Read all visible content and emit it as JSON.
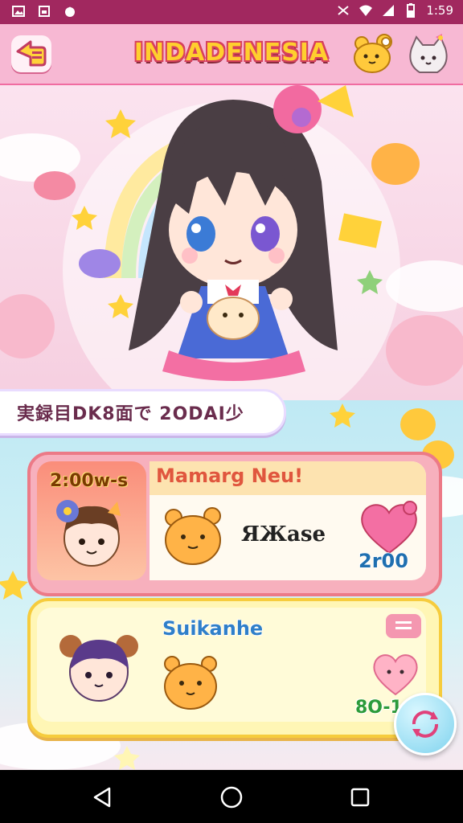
{
  "status_bar": {
    "time": "1:59",
    "left_icons": [
      "gallery-icon",
      "sim-icon",
      "notification-icon"
    ],
    "right_icons": [
      "vibrate-icon",
      "wifi-icon",
      "signal-icon",
      "battery-icon"
    ]
  },
  "app_bar": {
    "title": "INDADENESIA",
    "back_icon": "back-arrow-icon",
    "right_icons": [
      "bear-icon",
      "cat-icon"
    ]
  },
  "banner": {
    "text": "実録目DK8面で 2ODAI少"
  },
  "cards": [
    {
      "time": "2:00w-s",
      "name": "Mamarg Neu!",
      "label": "ЯЖаse",
      "count": "2r00",
      "icons": [
        "boy-avatar-icon",
        "bear-icon",
        "heart-icon"
      ]
    },
    {
      "title": "Suikanhe",
      "count": "8O-1.",
      "icons": [
        "girl-avatar-icon",
        "bear-icon",
        "heart-icon",
        "menu-icon"
      ]
    }
  ],
  "fab_icon": "refresh-icon",
  "nav_bar": {
    "icons": [
      "nav-back-icon",
      "nav-home-icon",
      "nav-recents-icon"
    ]
  },
  "colors": {
    "status_bar": "#a1285f",
    "app_bar": "#f7b8d3",
    "title_fill": "#ffcf2e",
    "card1_border": "#ec7a87",
    "card2_border": "#f6cc3d"
  }
}
